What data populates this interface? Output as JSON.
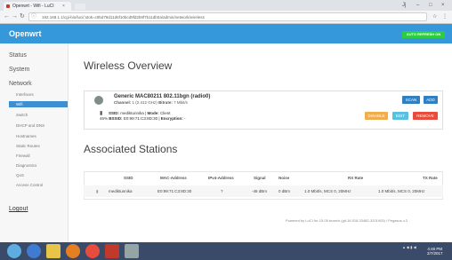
{
  "browser": {
    "tab_title": "Openwrt - Wifi - LuCI",
    "tab_close": "×",
    "url": "192.168.1.1/cgi-bin/luci/;stok=c9bd78d11d6f10bcd9fd2b9f7b11db0a/admin/network/wireless",
    "window_controls": [
      "Jj",
      "–",
      "□",
      "×"
    ]
  },
  "app": {
    "brand": "Openwrt",
    "auto_refresh": "AUTO REFRESH ON"
  },
  "sidebar": {
    "status": "Status",
    "system": "System",
    "network": "Network",
    "items": [
      "Interfaces",
      "Wifi",
      "Switch",
      "DHCP and DNS",
      "Hostnames",
      "Static Routes",
      "Firewall",
      "Diagnostics",
      "QoS",
      "Access Control"
    ],
    "logout": "Logout"
  },
  "wireless": {
    "title": "Wireless Overview",
    "radio_name": "Generic MAC80211 802.11bgn (radio0)",
    "channel_label": "Channel:",
    "channel_value": "1 (2.412 GHz)",
    "bitrate_label": "Bitrate:",
    "bitrate_value": "? Mbit/s",
    "scan_label": "SCAN",
    "add_label": "ADD",
    "ssid_label": "SSID:",
    "ssid_value": "mediktunnika",
    "mode_label": "Mode:",
    "mode_value": "Client",
    "signal_pct": "46%",
    "bssid_label": "BSSID:",
    "bssid_value": "E0:99:71:C3:8D:30",
    "encryption_label": "Encryption:",
    "encryption_value": "-",
    "disable_label": "DISABLE",
    "edit_label": "EDIT",
    "remove_label": "REMOVE"
  },
  "stations": {
    "title": "Associated Stations",
    "headers": [
      "SSID",
      "MAC-Address",
      "IPv4-Address",
      "Signal",
      "Noise",
      "RX Rate",
      "TX Rate"
    ],
    "rows": [
      [
        "mediktunnika",
        "E0:99:71:C3:8D:30",
        "?",
        "-48 dBm",
        "0 dBm",
        "1.0 Mbit/s, MCS 0, 20MHz",
        "1.0 Mbit/s, MCS 0, 20MHz"
      ]
    ]
  },
  "footer": "Powered by LuCI for-15.05 branch (git-16.018.33482-3201903) / Pegasus v.3",
  "taskbar": {
    "clock_time": "4:46 PM",
    "clock_date": "2/7/2017"
  },
  "colors": {
    "header_blue": "#3498db",
    "auto_refresh_green": "#2ecc40",
    "scan_blue": "#2f7fc1",
    "disable_orange": "#f0ad4e",
    "edit_blue": "#5bc0de",
    "remove_red": "#e74c3c",
    "taskbar": "#3a4a69"
  }
}
